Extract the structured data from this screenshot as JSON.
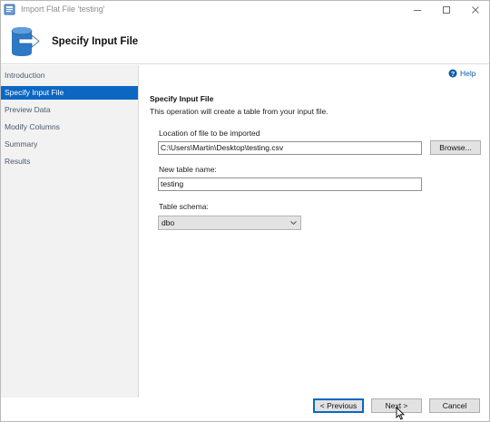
{
  "window": {
    "title": "Import Flat File 'testing'",
    "controls": {
      "minimize_icon": "minimize-icon",
      "maximize_icon": "maximize-icon",
      "close_icon": "close-icon"
    }
  },
  "header": {
    "title": "Specify Input File",
    "icon": "database-import-icon"
  },
  "sidebar": {
    "items": [
      {
        "label": "Introduction",
        "active": false
      },
      {
        "label": "Specify Input File",
        "active": true
      },
      {
        "label": "Preview Data",
        "active": false
      },
      {
        "label": "Modify Columns",
        "active": false
      },
      {
        "label": "Summary",
        "active": false
      },
      {
        "label": "Results",
        "active": false
      }
    ]
  },
  "main": {
    "help_label": "Help",
    "section_title": "Specify Input File",
    "section_description": "This operation will create a table from your input file.",
    "file_location": {
      "label": "Location of file to be imported",
      "value": "C:\\Users\\Martin\\Desktop\\testing.csv",
      "browse_label": "Browse..."
    },
    "table_name": {
      "label": "New table name:",
      "value": "testing"
    },
    "table_schema": {
      "label": "Table schema:",
      "selected": "dbo"
    }
  },
  "footer": {
    "previous_label": "< Previous",
    "next_label": "Next >",
    "cancel_label": "Cancel"
  },
  "colors": {
    "accent": "#0c67c2",
    "sidebar_bg": "#f2f2f2",
    "sidebar_text": "#4a5a6e",
    "help_link": "#0b5ba8"
  }
}
